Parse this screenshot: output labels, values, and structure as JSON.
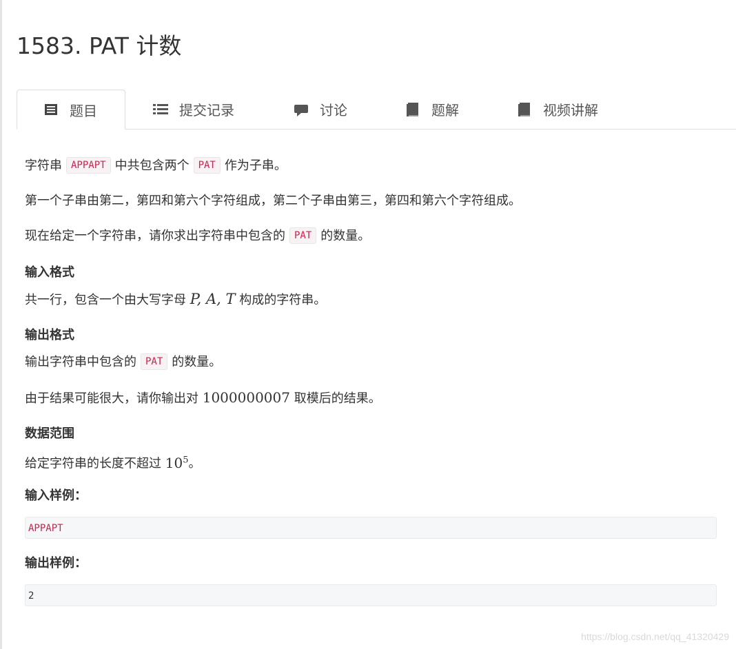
{
  "title": "1583. PAT 计数",
  "tabs": [
    {
      "label": "题目",
      "icon": "document-list-icon"
    },
    {
      "label": "提交记录",
      "icon": "list-icon"
    },
    {
      "label": "讨论",
      "icon": "comment-icon"
    },
    {
      "label": "题解",
      "icon": "book-icon"
    },
    {
      "label": "视频讲解",
      "icon": "book-icon"
    }
  ],
  "desc": {
    "p1_a": "字符串",
    "p1_code1": "APPAPT",
    "p1_b": "中共包含两个",
    "p1_code2": "PAT",
    "p1_c": "作为子串。",
    "p2": "第一个子串由第二，第四和第六个字符组成，第二个子串由第三，第四和第六个字符组成。",
    "p3_a": "现在给定一个字符串，请你求出字符串中包含的",
    "p3_code": "PAT",
    "p3_b": "的数量。"
  },
  "input_format": {
    "heading": "输入格式",
    "text_a": "共一行，包含一个由大写字母",
    "math": "P, A, T",
    "text_b": "构成的字符串。"
  },
  "output_format": {
    "heading": "输出格式",
    "line1_a": "输出字符串中包含的",
    "line1_code": "PAT",
    "line1_b": "的数量。",
    "line2_a": "由于结果可能很大，请你输出对",
    "line2_num": "1000000007",
    "line2_b": "取模后的结果。"
  },
  "range": {
    "heading": "数据范围",
    "text_a": "给定字符串的长度不超过",
    "base": "10",
    "exp": "5",
    "text_b": "。"
  },
  "sample_input": {
    "heading": "输入样例：",
    "value": "APPAPT"
  },
  "sample_output": {
    "heading": "输出样例：",
    "value": "2"
  },
  "watermark": "https://blog.csdn.net/qq_41320429"
}
